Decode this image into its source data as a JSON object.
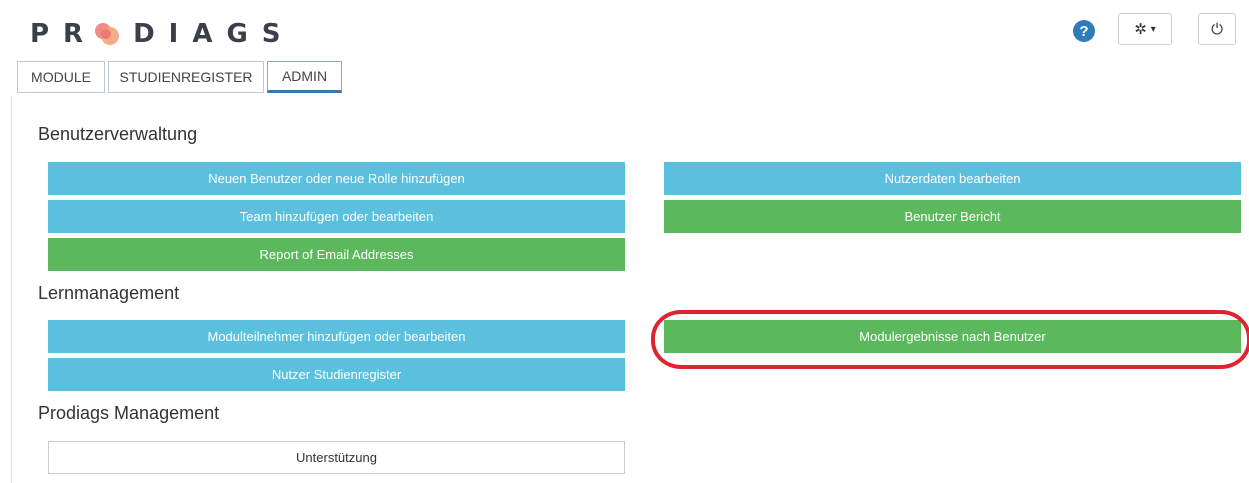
{
  "logo": {
    "text_before": "PR",
    "text_after": "DIAGS"
  },
  "header": {
    "help_icon": "?",
    "settings_icon": "✲",
    "settings_caret": "▾",
    "power_icon": "⏻"
  },
  "tabs": [
    {
      "label": "MODULE"
    },
    {
      "label": "STUDIENREGISTER"
    },
    {
      "label": "ADMIN",
      "active": true
    }
  ],
  "sections": {
    "user_admin": {
      "title": "Benutzerverwaltung",
      "add_user": "Neuen Benutzer oder neue Rolle hinzufügen",
      "edit_team": "Team hinzufügen oder bearbeiten",
      "email_report": "Report of Email Addresses",
      "edit_userdata": "Nutzerdaten bearbeiten",
      "user_report": "Benutzer Bericht"
    },
    "learning": {
      "title": "Lernmanagement",
      "module_participants": "Modulteilnehmer hinzufügen oder bearbeiten",
      "user_registry": "Nutzer Studienregister",
      "module_results": "Modulergebnisse nach Benutzer"
    },
    "prodiags": {
      "title": "Prodiags Management",
      "support": "Unterstützung"
    }
  },
  "colors": {
    "blue_button": "#5bc0de",
    "green_button": "#5cb85c",
    "highlight": "#e0242f",
    "tab_active": "#3a76a8"
  }
}
